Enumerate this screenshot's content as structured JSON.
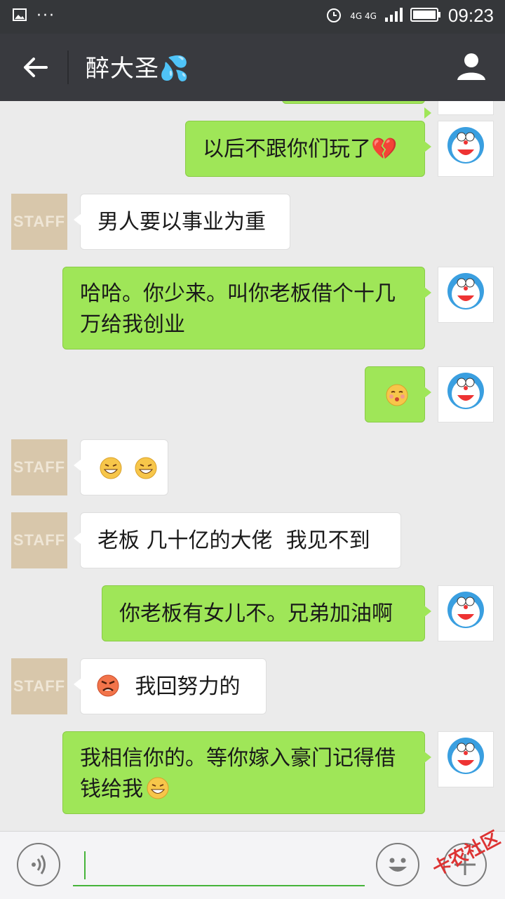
{
  "status_bar": {
    "network": "4G 4G",
    "time": "09:23"
  },
  "header": {
    "title": "醉大圣💦"
  },
  "messages": [
    {
      "dir": "out",
      "text": "以后不跟你们玩了💔"
    },
    {
      "dir": "in",
      "text": "男人要以事业为重"
    },
    {
      "dir": "out",
      "text": "哈哈。你少来。叫你老板借个十几万给我创业"
    },
    {
      "dir": "out",
      "text": ""
    },
    {
      "dir": "in",
      "text": ""
    },
    {
      "dir": "in",
      "text": "老板 几十亿的大佬  我见不到"
    },
    {
      "dir": "out",
      "text": "你老板有女儿不。兄弟加油啊"
    },
    {
      "dir": "in",
      "text": "我回努力的"
    },
    {
      "dir": "out",
      "text": "我相信你的。等你嫁入豪门记得借钱给我"
    }
  ],
  "avatar_label": "STAFF",
  "watermark": "卡农社区"
}
